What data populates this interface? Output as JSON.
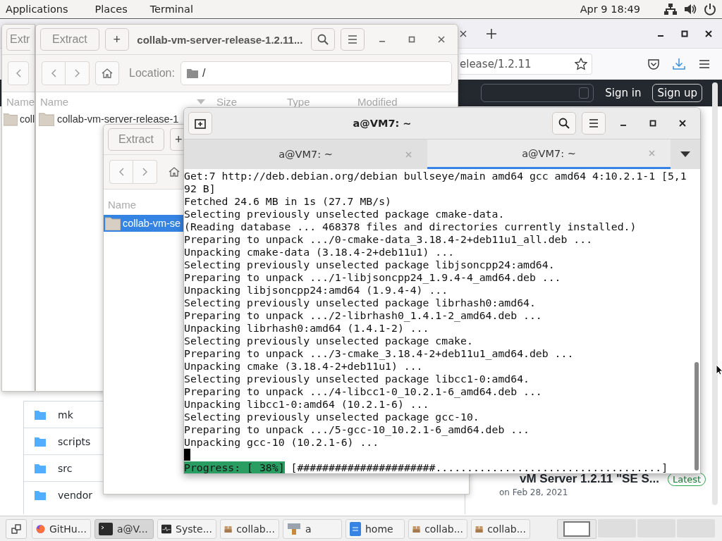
{
  "top_bar": {
    "menus": [
      "Applications",
      "Places",
      "Terminal"
    ],
    "clock": "Apr 9  18:49"
  },
  "browser": {
    "url": "elease/1.2.11",
    "header_buttons": [
      "Sign in",
      "Sign up"
    ],
    "files": [
      {
        "name": "mk"
      },
      {
        "name": "scripts"
      },
      {
        "name": "src"
      },
      {
        "name": "vendor"
      }
    ],
    "release": {
      "title": "vM Server 1.2.11 \"SE S...",
      "badge": "Latest",
      "date": "on Feb 28, 2021"
    }
  },
  "archive_back": {
    "extract": "Extr",
    "column": "Name",
    "row": "coll"
  },
  "archive_main": {
    "extract": "Extract",
    "add": "+",
    "title": "collab-vm-server-release-1.2.11...",
    "location_label": "Location:",
    "location": "/",
    "columns": [
      "Name",
      "Size",
      "Type",
      "Modified"
    ],
    "row": "collab-vm-server-release-1"
  },
  "archive_front": {
    "extract": "Extract",
    "add": "+",
    "column": "Name",
    "row": {
      "name": "collab-vm-se",
      "selected": true
    }
  },
  "terminal": {
    "title": "a@VM7: ~",
    "tabs": [
      {
        "label": "a@VM7: ~",
        "selected": false
      },
      {
        "label": "a@VM7: ~",
        "selected": true
      }
    ],
    "lines": [
      "Get:7 http://deb.debian.org/debian bullseye/main amd64 gcc amd64 4:10.2.1-1 [5,1",
      "92 B]",
      "Fetched 24.6 MB in 1s (27.7 MB/s)",
      "Selecting previously unselected package cmake-data.",
      "(Reading database ... 468378 files and directories currently installed.)",
      "Preparing to unpack .../0-cmake-data_3.18.4-2+deb11u1_all.deb ...",
      "Unpacking cmake-data (3.18.4-2+deb11u1) ...",
      "Selecting previously unselected package libjsoncpp24:amd64.",
      "Preparing to unpack .../1-libjsoncpp24_1.9.4-4_amd64.deb ...",
      "Unpacking libjsoncpp24:amd64 (1.9.4-4) ...",
      "Selecting previously unselected package librhash0:amd64.",
      "Preparing to unpack .../2-librhash0_1.4.1-2_amd64.deb ...",
      "Unpacking librhash0:amd64 (1.4.1-2) ...",
      "Selecting previously unselected package cmake.",
      "Preparing to unpack .../3-cmake_3.18.4-2+deb11u1_amd64.deb ...",
      "Unpacking cmake (3.18.4-2+deb11u1) ...",
      "Selecting previously unselected package libcc1-0:amd64.",
      "Preparing to unpack .../4-libcc1-0_10.2.1-6_amd64.deb ...",
      "Unpacking libcc1-0:amd64 (10.2.1-6) ...",
      "Selecting previously unselected package gcc-10.",
      "Preparing to unpack .../5-gcc-10_10.2.1-6_amd64.deb ...",
      "Unpacking gcc-10 (10.2.1-6) ..."
    ],
    "progress": {
      "label": "Progress: [ 38%]",
      "bar": "[######################....................................]"
    }
  },
  "taskbar": {
    "items": [
      {
        "label": "GitHu...",
        "kind": "browser",
        "selected": false
      },
      {
        "label": "a@V...",
        "kind": "terminal",
        "selected": true
      },
      {
        "label": "Syste...",
        "kind": "monitor",
        "selected": false
      },
      {
        "label": "collab...",
        "kind": "archive",
        "selected": false
      },
      {
        "label": "a",
        "kind": "drive",
        "selected": false
      },
      {
        "label": "home",
        "kind": "document",
        "selected": false
      },
      {
        "label": "collab...",
        "kind": "archive",
        "selected": false
      },
      {
        "label": "collab...",
        "kind": "archive",
        "selected": false
      }
    ],
    "workspaces": [
      {
        "selected": true
      },
      {
        "selected": false
      },
      {
        "selected": false
      },
      {
        "selected": false
      }
    ]
  }
}
